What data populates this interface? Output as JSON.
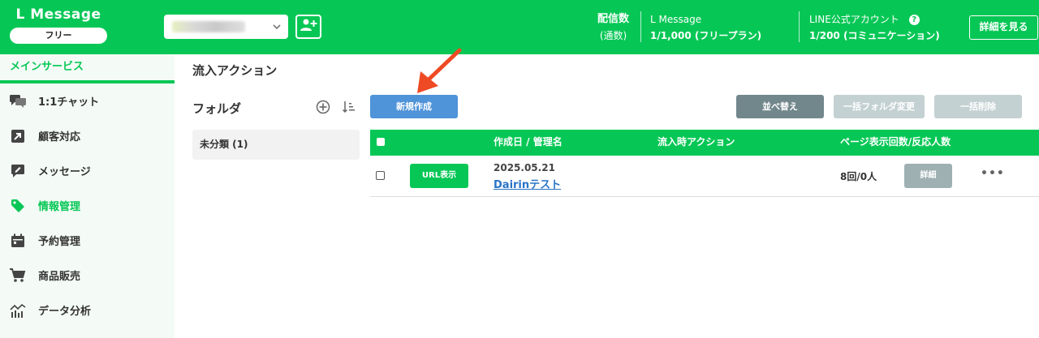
{
  "header": {
    "brand_title": "L Message",
    "plan_badge": "フリー",
    "stat_label": "配信数",
    "stat_sub": "(通数)",
    "lmessage_label": "L Message",
    "lmessage_value": "1/1,000 (フリープラン)",
    "line_label": "LINE公式アカウント",
    "line_value": "1/200 (コミュニケーション)",
    "detail_button": "詳細を見る",
    "help_icon": "?"
  },
  "sidebar": {
    "section": "メインサービス",
    "items": [
      {
        "label": "1:1チャット",
        "icon": "chat-icon"
      },
      {
        "label": "顧客対応",
        "icon": "arrow-box-icon"
      },
      {
        "label": "メッセージ",
        "icon": "message-icon"
      },
      {
        "label": "情報管理",
        "icon": "tag-icon"
      },
      {
        "label": "予約管理",
        "icon": "calendar-icon"
      },
      {
        "label": "商品販売",
        "icon": "cart-icon"
      },
      {
        "label": "データ分析",
        "icon": "chart-icon"
      }
    ],
    "active_index": 3
  },
  "main": {
    "page_title": "流入アクション",
    "folder_title": "フォルダ",
    "folders": [
      {
        "label": "未分類 (1)"
      }
    ],
    "buttons": {
      "new": "新規作成",
      "sort": "並べ替え",
      "folder_change": "一括フォルダ変更",
      "bulk_delete": "一括削除"
    },
    "table": {
      "columns": [
        "作成日 / 管理名",
        "流入時アクション",
        "ページ表示回数/反応人数"
      ],
      "rows": [
        {
          "url_button": "URL表示",
          "date": "2025.05.21",
          "name": "Dairinテスト",
          "action": "",
          "count": "8回/0人",
          "detail": "詳細",
          "more": "•••"
        }
      ]
    }
  },
  "colors": {
    "brand_green": "#06c755",
    "primary_blue": "#4f93d8",
    "annotation_arrow": "#ee4a24"
  }
}
